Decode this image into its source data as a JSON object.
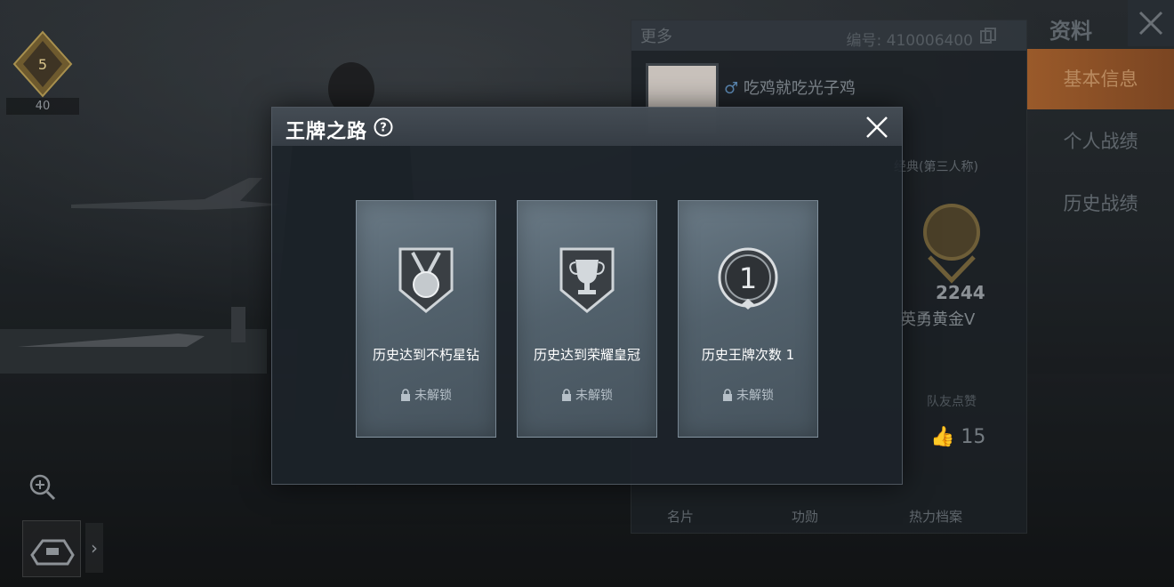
{
  "player_rank": {
    "level": "40",
    "badge_number": "5"
  },
  "profile_panel": {
    "more_label": "更多",
    "id_label": "编号: 410006400",
    "player_name": "吃鸡就吃光子鸡",
    "gender_symbol": "♂",
    "mode_label": "经典(第三人称)",
    "score": "2244",
    "tier": "英勇黄金Ⅴ",
    "likes_label": "队友点赞",
    "likes_count": "15",
    "footer_tabs": [
      "名片",
      "功勋",
      "热力档案"
    ]
  },
  "side_panel": {
    "title": "资料",
    "items": [
      {
        "label": "基本信息",
        "active": true
      },
      {
        "label": "个人战绩",
        "active": false
      },
      {
        "label": "历史战绩",
        "active": false
      }
    ]
  },
  "dialog": {
    "title": "王牌之路",
    "cards": [
      {
        "name": "历史达到不朽星钻",
        "status": "未解锁",
        "icon": "medal-icon"
      },
      {
        "name": "历史达到荣耀皇冠",
        "status": "未解锁",
        "icon": "trophy-icon"
      },
      {
        "name": "历史王牌次数 1",
        "status": "未解锁",
        "icon": "number-one-badge-icon"
      }
    ]
  },
  "colors": {
    "accent_orange": "#9a5a2a",
    "card_bg": "#56656f",
    "dialog_bg": "#1c232a"
  }
}
